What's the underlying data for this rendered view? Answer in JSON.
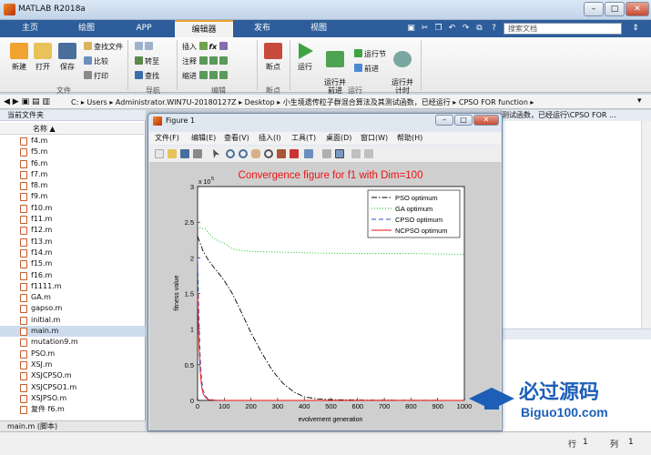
{
  "app": {
    "title": "MATLAB R2018a"
  },
  "ribbon_tabs": [
    "主页",
    "绘图",
    "APP",
    "编辑器",
    "发布",
    "视图"
  ],
  "search": {
    "placeholder": "搜索文档"
  },
  "ribbon": {
    "file_group": {
      "new": "新建",
      "open": "打开",
      "save": "保存",
      "find_files": "查找文件",
      "compare": "比较",
      "print": "打印",
      "label": "文件"
    },
    "nav_group": {
      "goto": "转至",
      "find": "查找",
      "label": "导航"
    },
    "edit_group": {
      "insert": "插入",
      "comment": "注释",
      "indent": "缩进",
      "label": "编辑"
    },
    "breakpoint_group": {
      "breakpoints": "断点",
      "label": "断点"
    },
    "run_group": {
      "run": "运行",
      "run_and_advance": "运行并\n前进",
      "run_section": "运行节",
      "advance": "前进",
      "run_and_time": "运行并\n计时",
      "label": "运行"
    }
  },
  "address": {
    "segments": [
      "C:",
      "Users",
      "Administrator.WIN7U-20180127Z",
      "Desktop",
      "小生境遗传粒子群混合算法及其测试函数，已经运行",
      "CPSO FOR function"
    ]
  },
  "left_panel": {
    "title": "当前文件夹",
    "column": "名称 ▲",
    "files": [
      "f4.m",
      "f5.m",
      "f6.m",
      "f7.m",
      "f8.m",
      "f9.m",
      "f10.m",
      "f11.m",
      "f12.m",
      "f13.m",
      "f14.m",
      "f15.m",
      "f16.m",
      "f1111.m",
      "GA.m",
      "gapso.m",
      "initial.m",
      "main.m",
      "mutation9.m",
      "PSO.m",
      "XSJ.m",
      "XSJCPSO.m",
      "XSJCPSO1.m",
      "XSJPSO.m",
      "复件 f6.m"
    ],
    "selected": "main.m",
    "details": "main.m  (脚本)"
  },
  "right_panel": {
    "header": "测试函数，已经运行\\CPSO FOR ..."
  },
  "status": {
    "line_label": "行",
    "line": "1",
    "col_label": "列",
    "col": "1"
  },
  "figure": {
    "title": "Figure 1",
    "menu": [
      "文件(F)",
      "编辑(E)",
      "查看(V)",
      "插入(I)",
      "工具(T)",
      "桌面(D)",
      "窗口(W)",
      "帮助(H)"
    ]
  },
  "chart_data": {
    "type": "line",
    "title": "Convergence figure for f1 with Dim=100",
    "xlabel": "evolvement generation",
    "ylabel": "fitness value",
    "xlim": [
      0,
      1000
    ],
    "ylim": [
      0,
      3
    ],
    "y_exponent_label": "x 10",
    "y_exponent": "5",
    "xticks": [
      0,
      100,
      200,
      300,
      400,
      500,
      600,
      700,
      800,
      900,
      1000
    ],
    "yticks": [
      0,
      0.5,
      1,
      1.5,
      2,
      2.5,
      3
    ],
    "legend_position": "top-right",
    "series": [
      {
        "name": "PSO optimum",
        "color": "#000000",
        "dash": "6,2,1.5,2",
        "x": [
          0,
          10,
          20,
          40,
          60,
          80,
          100,
          130,
          160,
          200,
          240,
          280,
          320,
          360,
          400,
          450,
          500,
          600,
          800,
          1000
        ],
        "y": [
          2.3,
          2.2,
          2.1,
          1.97,
          1.87,
          1.78,
          1.68,
          1.5,
          1.27,
          0.95,
          0.67,
          0.42,
          0.24,
          0.12,
          0.05,
          0.02,
          0.01,
          0.005,
          0.002,
          0.001
        ]
      },
      {
        "name": "GA optimum",
        "color": "#00c000",
        "dash": "1,2",
        "x": [
          0,
          10,
          30,
          60,
          90,
          110,
          130,
          150,
          200,
          300,
          400,
          600,
          800,
          1000
        ],
        "y": [
          2.45,
          2.42,
          2.4,
          2.27,
          2.22,
          2.18,
          2.13,
          2.11,
          2.09,
          2.08,
          2.07,
          2.06,
          2.06,
          2.05
        ]
      },
      {
        "name": "CPSO optimum",
        "color": "#3355cc",
        "dash": "5,3",
        "x": [
          0,
          5,
          10,
          15,
          20,
          30,
          40,
          60,
          100,
          1000
        ],
        "y": [
          2.0,
          1.2,
          0.6,
          0.3,
          0.15,
          0.06,
          0.02,
          0.005,
          0.0,
          0.0
        ]
      },
      {
        "name": "NCPSO optimum",
        "color": "#ee1111",
        "dash": "",
        "x": [
          0,
          5,
          10,
          15,
          20,
          30,
          40,
          60,
          100,
          1000
        ],
        "y": [
          1.5,
          0.8,
          0.4,
          0.2,
          0.1,
          0.04,
          0.01,
          0.002,
          0.0,
          0.0
        ]
      }
    ]
  },
  "watermark": {
    "title": "必过源码",
    "url": "Biguo100.com"
  }
}
